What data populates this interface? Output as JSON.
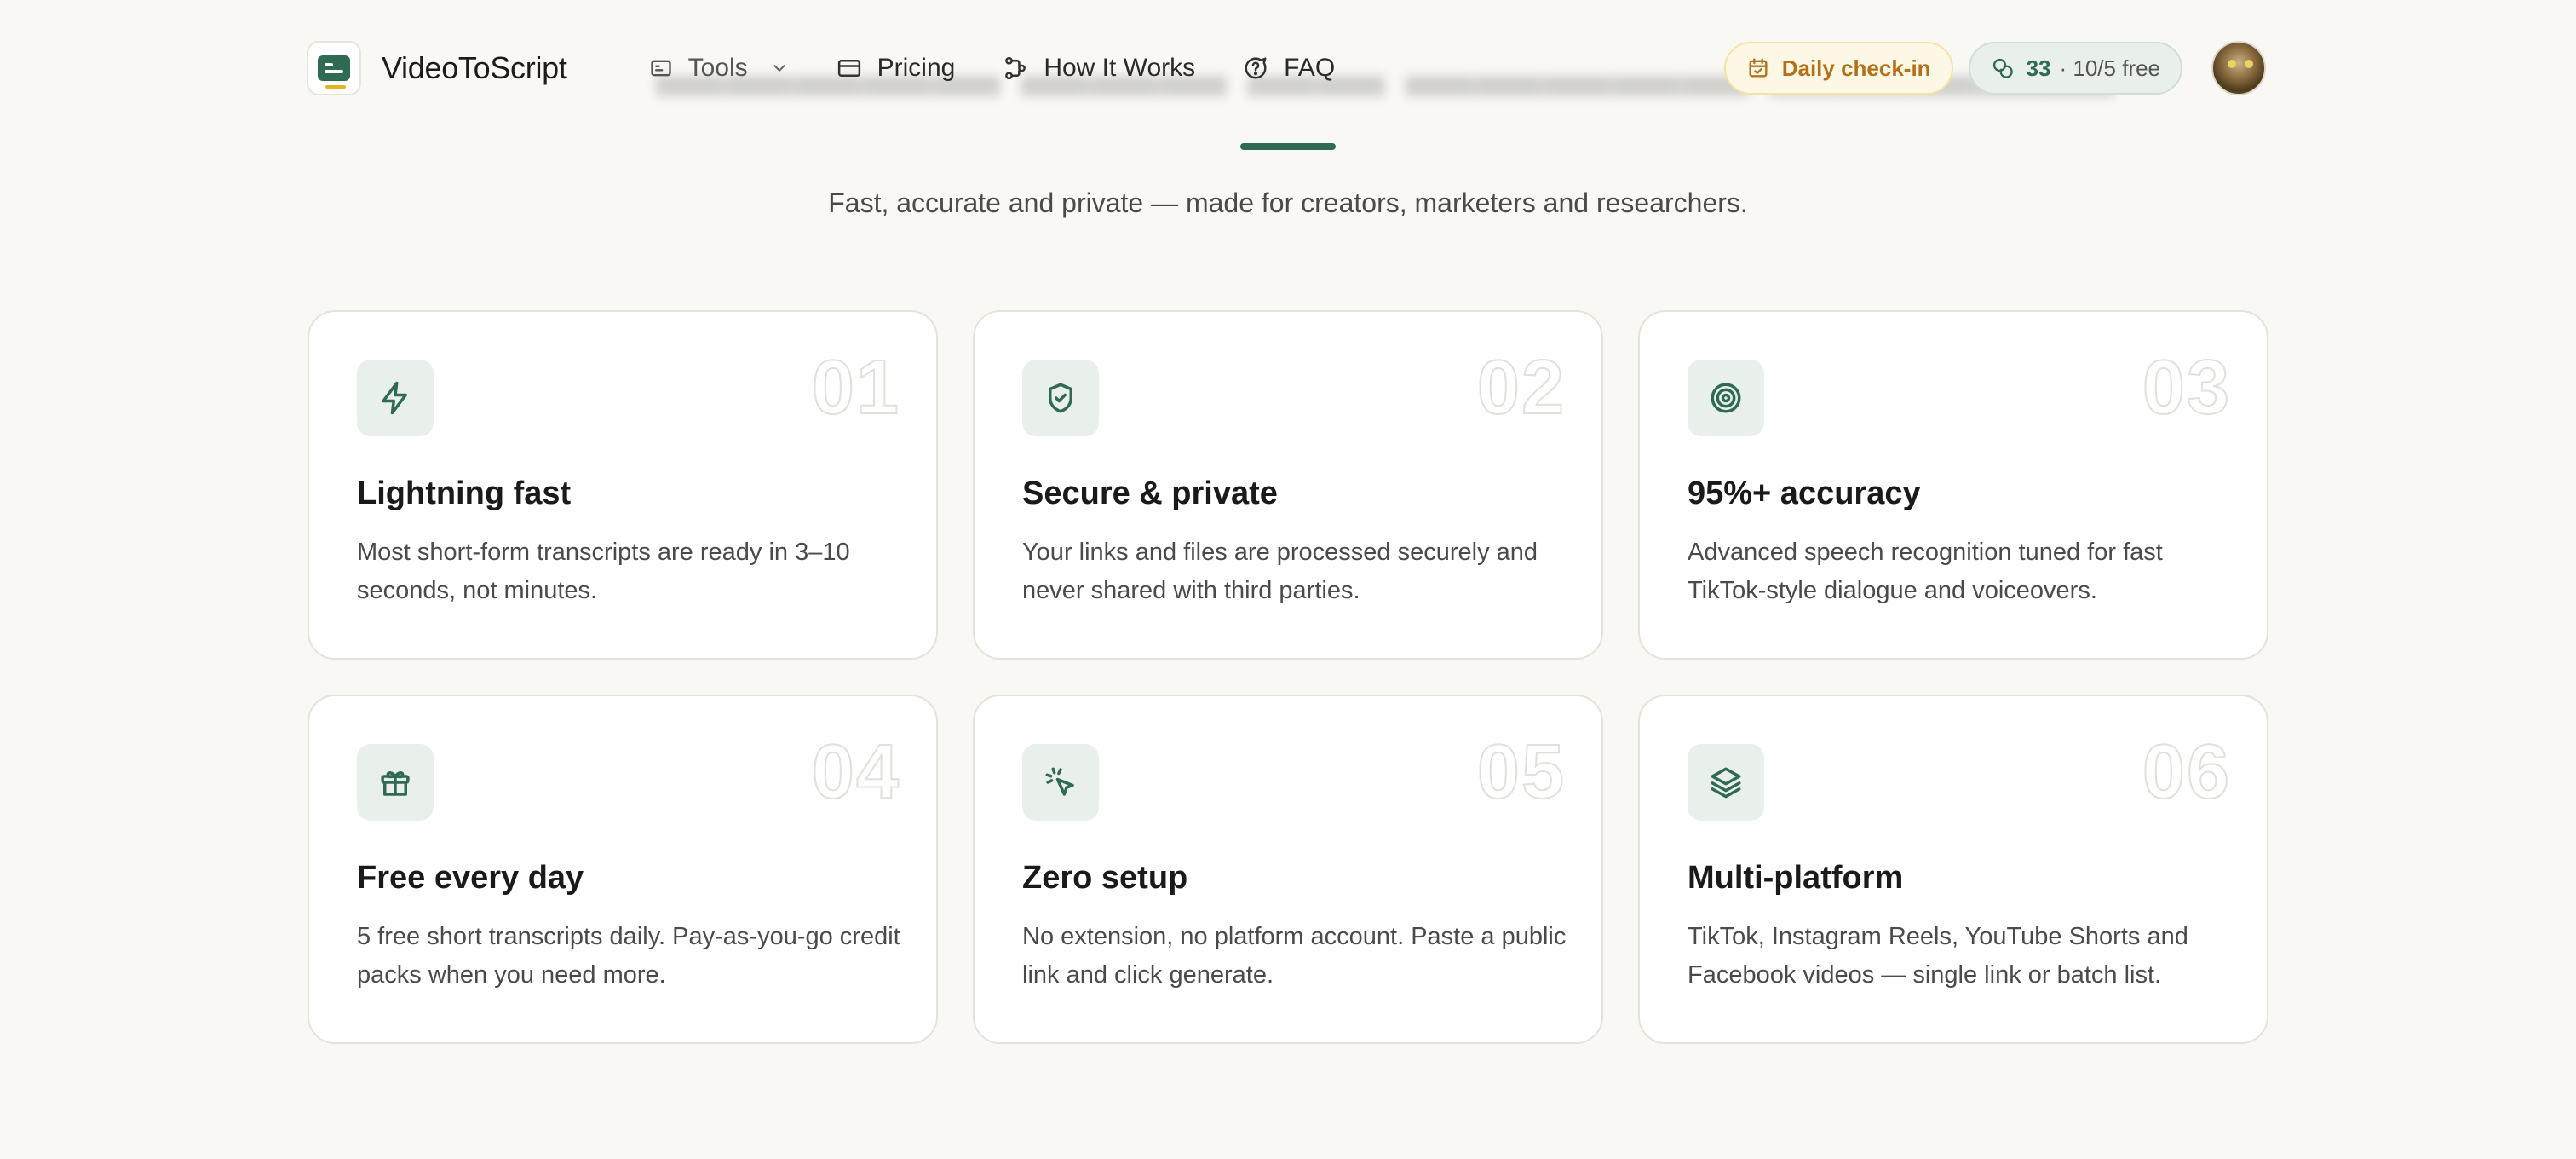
{
  "header": {
    "brand": "VideoToScript",
    "nav": {
      "tools": "Tools",
      "pricing": "Pricing",
      "how_it_works": "How It Works",
      "faq": "FAQ"
    },
    "checkin_label": "Daily check-in",
    "credits_count": "33",
    "credits_free": "· 10/5 free"
  },
  "hero": {
    "subtitle": "Fast, accurate and private — made for creators, marketers and researchers."
  },
  "features": [
    {
      "number": "01",
      "title": "Lightning fast",
      "desc": "Most short-form transcripts are ready in 3–10 seconds, not minutes.",
      "icon": "lightning-icon"
    },
    {
      "number": "02",
      "title": "Secure & private",
      "desc": "Your links and files are processed securely and never shared with third parties.",
      "icon": "shield-check-icon"
    },
    {
      "number": "03",
      "title": "95%+ accuracy",
      "desc": "Advanced speech recognition tuned for fast TikTok-style dialogue and voiceovers.",
      "icon": "target-icon"
    },
    {
      "number": "04",
      "title": "Free every day",
      "desc": "5 free short transcripts daily. Pay-as-you-go credit packs when you need more.",
      "icon": "gift-icon"
    },
    {
      "number": "05",
      "title": "Zero setup",
      "desc": "No extension, no platform account. Paste a public link and click generate.",
      "icon": "cursor-click-icon"
    },
    {
      "number": "06",
      "title": "Multi-platform",
      "desc": "TikTok, Instagram Reels, YouTube Shorts and Facebook videos — single link or batch list.",
      "icon": "layers-icon"
    }
  ],
  "colors": {
    "accent": "#2f6b52",
    "background": "#f9f8f4",
    "checkin_text": "#b5711a"
  }
}
